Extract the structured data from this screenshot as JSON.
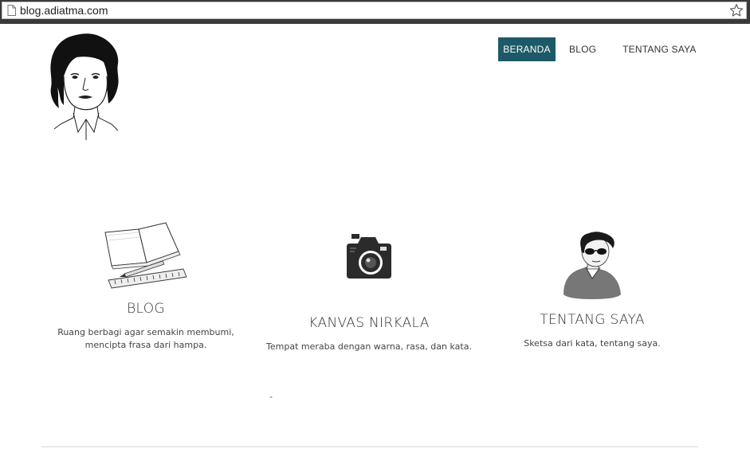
{
  "browser": {
    "url": "blog.adiatma.com"
  },
  "nav": {
    "items": [
      {
        "label": "BERANDA",
        "active": true
      },
      {
        "label": "BLOG",
        "active": false
      },
      {
        "label": "TENTANG SAYA",
        "active": false
      }
    ]
  },
  "features": [
    {
      "title": "BLOG",
      "description_line1": "Ruang berbagi agar semakin membumi,",
      "description_line2": "mencipta frasa dari hampa.",
      "illustration": "notebook-pencil-ruler-icon"
    },
    {
      "title": "KANVAS NIRKALA",
      "description_line1": "Tempat meraba dengan warna, rasa, dan kata.",
      "illustration": "camera-icon"
    },
    {
      "title": "TENTANG SAYA",
      "description_line1": "Sketsa dari kata, tentang saya.",
      "illustration": "person-sunglasses-icon"
    }
  ],
  "misc": {
    "stray_text": "-"
  },
  "colors": {
    "nav_active_bg": "#1d5a67",
    "nav_active_text": "#ffffff",
    "text": "#333333"
  }
}
